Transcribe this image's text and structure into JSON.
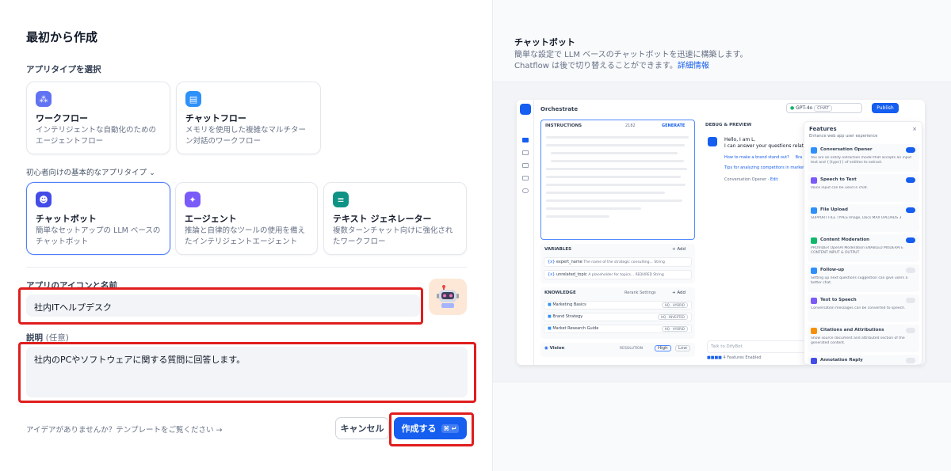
{
  "page_title": "最初から作成",
  "app_type_label": "アプリタイプを選択",
  "beginner_label": "初心者向けの基本的なアプリタイプ",
  "types_top": [
    {
      "title": "ワークフロー",
      "desc": "インテリジェントな自動化のためのエージェントフロー",
      "icon": "workflow-icon"
    },
    {
      "title": "チャットフロー",
      "desc": "メモリを使用した複雑なマルチターン対話のワークフロー",
      "icon": "chatflow-icon"
    }
  ],
  "types_basic": [
    {
      "title": "チャットボット",
      "desc": "簡単なセットアップの LLM ベースのチャットボット",
      "icon": "chatbot-icon"
    },
    {
      "title": "エージェント",
      "desc": "推論と自律的なツールの使用を備えたインテリジェントエージェント",
      "icon": "agent-icon"
    },
    {
      "title": "テキスト ジェネレーター",
      "desc": "複数ターンチャット向けに強化されたワークフロー",
      "icon": "text-generator-icon"
    }
  ],
  "name_label": "アプリのアイコンと名前",
  "name_value": "社内ITヘルプデスク",
  "desc_label": "説明",
  "desc_optional": "(任意)",
  "desc_value": "社内のPCやソフトウェアに関する質問に回答します。",
  "idea_text": "アイデアがありませんか？テンプレートをご覧ください",
  "cancel_label": "キャンセル",
  "create_label": "作成する",
  "create_shortcut": "⌘ ↵",
  "preview": {
    "title": "チャットボット",
    "desc": "簡単な設定で LLM ベースのチャットボットを迅速に構築します。Chatflow は後で切り替えることができます。",
    "link": "詳細情報",
    "orchestrate": "Orchestrate",
    "model": "GPT-4o",
    "model_tag": "CHAT",
    "publish": "Publish",
    "instructions": "INSTRUCTIONS",
    "instr_count": "2182",
    "generate": "GENERATE",
    "debug": "DEBUG & PREVIEW",
    "hello": "Hello, I am L.",
    "hello2": "I can answer your questions related",
    "q1": "How to make a brand stand out?",
    "q1b": "Bra",
    "q2": "Tips for analyzing competitors in market",
    "opener": "Conversation Opener",
    "edit": "Edit",
    "variables": "VARIABLES",
    "add": "+ Add",
    "var1_name": "expert_name",
    "var1_desc": "The name of the strategic consulting...",
    "var1_type": "String",
    "var2_name": "unrelated_topic",
    "var2_desc": "A placeholder for topics...",
    "var2_req": "REQUIRED",
    "var2_type": "String",
    "knowledge": "KNOWLEDGE",
    "rerank": "Rerank Settings",
    "k1": "Marketing Basics",
    "k1_tag": "HQ · HYBRID",
    "k2": "Brand Strategy",
    "k2_tag": "HQ · INVERTED",
    "k3": "Market Research Guide",
    "k3_tag": "HQ · HYBRID",
    "vision": "Vision",
    "resolution": "RESOLUTION",
    "high": "High",
    "low": "Low",
    "talk": "Talk to DifyBot",
    "features_enabled": "4 Features Enabled",
    "features": "Features",
    "features_sub": "Enhance web app user experience",
    "f_list": [
      {
        "name": "Conversation Opener",
        "desc": "You are an entity extraction model that accepts an input text and {{type}} of entities to extract.",
        "on": true,
        "color": "#2e90fa"
      },
      {
        "name": "Speech to Text",
        "desc": "Voice input can be used in chat.",
        "on": true,
        "color": "#7a5af8"
      },
      {
        "name": "File Upload",
        "desc": "SUPPORT FILE TYPES  Image, Docs   MAX UPLOADS 3",
        "on": true,
        "color": "#2e90fa"
      },
      {
        "name": "Content Moderation",
        "desc": "PROVIDER OpenAI Moderation  ENABLED MODERATE CONTENT INPUT & OUTPUT",
        "on": true,
        "color": "#12b76a"
      },
      {
        "name": "Follow-up",
        "desc": "Setting up next questions suggestion can give users a better chat.",
        "on": false,
        "color": "#2e90fa"
      },
      {
        "name": "Text to Speech",
        "desc": "Conversation messages can be converted to speech.",
        "on": false,
        "color": "#7a5af8"
      },
      {
        "name": "Citations and Attributions",
        "desc": "Show source document and attributed section of the generated content.",
        "on": false,
        "color": "#f79009"
      },
      {
        "name": "Annotation Reply",
        "desc": "",
        "on": false,
        "color": "#444ce7"
      }
    ]
  }
}
